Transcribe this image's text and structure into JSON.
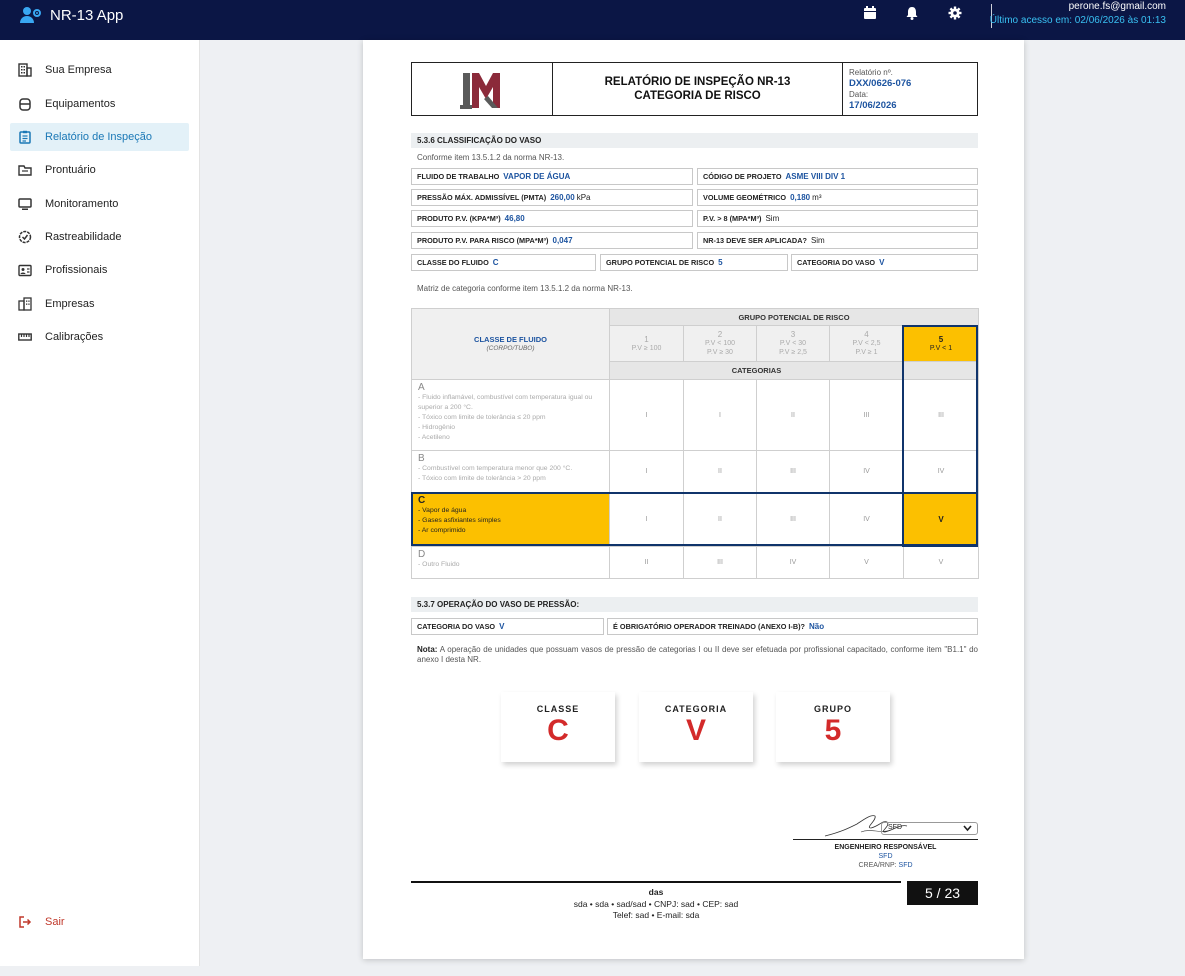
{
  "app": {
    "title": "NR-13 App"
  },
  "topbar": {
    "user_email": "perone.fs@gmail.com",
    "last_access": "Último acesso em: 02/06/2026 às 01:13"
  },
  "sidebar": {
    "items": [
      {
        "label": "Sua Empresa",
        "icon": "building-icon"
      },
      {
        "label": "Equipamentos",
        "icon": "tank-icon"
      },
      {
        "label": "Relatório de Inspeção",
        "icon": "clipboard-icon"
      },
      {
        "label": "Prontuário",
        "icon": "folder-icon"
      },
      {
        "label": "Monitoramento",
        "icon": "monitor-icon"
      },
      {
        "label": "Rastreabilidade",
        "icon": "badge-check-icon"
      },
      {
        "label": "Profissionais",
        "icon": "id-card-icon"
      },
      {
        "label": "Empresas",
        "icon": "buildings-icon"
      },
      {
        "label": "Calibrações",
        "icon": "ruler-icon"
      }
    ],
    "logout": "Sair"
  },
  "report": {
    "title_line1": "RELATÓRIO DE INSPEÇÃO NR-13",
    "title_line2": "CATEGORIA DE RISCO",
    "number_label": "Relatório nº.",
    "number": "DXX/0626-076",
    "date_label": "Data:",
    "date": "17/06/2026",
    "sec1_title": "5.3.6 CLASSIFICAÇÃO DO VASO",
    "sec1_note": "Conforme item 13.5.1.2 da norma NR-13.",
    "fields": {
      "fluido_label": "FLUIDO DE TRABALHO",
      "fluido": "VAPOR DE ÁGUA",
      "codigo_label": "CÓDIGO DE PROJETO",
      "codigo": "ASME VIII DIV 1",
      "pmta_label": "PRESSÃO MÁX. ADMISSÍVEL (PMTA)",
      "pmta": "260,00",
      "pmta_unit": "kPa",
      "volume_label": "VOLUME GEOMÉTRICO",
      "volume": "0,180",
      "volume_unit": "m³",
      "pv_label": "PRODUTO P.V. (KPA*M³)",
      "pv": "46,80",
      "pv8_label": "P.V. > 8 (MPA*M³)",
      "pv8": "Sim",
      "pvrisco_label": "PRODUTO P.V. PARA RISCO (MPA*M³)",
      "pvrisco": "0,047",
      "nr13_label": "NR-13 DEVE SER APLICADA?",
      "nr13": "Sim",
      "classe_label": "CLASSE DO FLUIDO",
      "classe": "C",
      "grupo_label": "GRUPO POTENCIAL DE RISCO",
      "grupo": "5",
      "categoria_label": "CATEGORIA DO VASO",
      "categoria": "V"
    },
    "matrix_note": "Matriz de categoria conforme item 13.5.1.2 da norma NR-13.",
    "matrix": {
      "group_header": "GRUPO POTENCIAL DE RISCO",
      "class_header": "CLASSE DE FLUIDO",
      "class_sub": "(CORPO/TUBO)",
      "categories_header": "CATEGORIAS",
      "groups": [
        {
          "n": "1",
          "l1": "P.V ≥ 100",
          "l2": ""
        },
        {
          "n": "2",
          "l1": "P.V < 100",
          "l2": "P.V ≥ 30"
        },
        {
          "n": "3",
          "l1": "P.V < 30",
          "l2": "P.V ≥ 2,5"
        },
        {
          "n": "4",
          "l1": "P.V < 2,5",
          "l2": "P.V ≥ 1"
        },
        {
          "n": "5",
          "l1": "P.V < 1",
          "l2": ""
        }
      ],
      "rows": [
        {
          "cls": "A",
          "desc": [
            "- Fluido inflamável, combustível com temperatura igual ou superior a 200 °C.",
            "- Tóxico com limite de tolerância ≤ 20 ppm",
            "- Hidrogênio",
            "- Acetileno"
          ],
          "cats": [
            "I",
            "I",
            "II",
            "III",
            "III"
          ]
        },
        {
          "cls": "B",
          "desc": [
            "- Combustível com temperatura menor que 200 °C.",
            "- Tóxico com limite de tolerância > 20 ppm"
          ],
          "cats": [
            "I",
            "II",
            "III",
            "IV",
            "IV"
          ]
        },
        {
          "cls": "C",
          "desc": [
            "- Vapor de água",
            "- Gases asfixiantes simples",
            "- Ar comprimido"
          ],
          "cats": [
            "I",
            "II",
            "III",
            "IV",
            "V"
          ]
        },
        {
          "cls": "D",
          "desc": [
            "- Outro Fluido"
          ],
          "cats": [
            "II",
            "III",
            "IV",
            "V",
            "V"
          ]
        }
      ],
      "selected_row": 2,
      "selected_col": 4
    },
    "sec2_title": "5.3.7 OPERAÇÃO DO VASO DE PRESSÃO:",
    "sec2": {
      "cat_label": "CATEGORIA DO VASO",
      "cat": "V",
      "op_label": "É OBRIGATÓRIO OPERADOR TREINADO (ANEXO I-B)?",
      "op": "Não"
    },
    "nota_label": "Nota:",
    "nota": "A operação de unidades que possuam vasos de pressão de categorias I ou II deve ser efetuada por profissional capacitado, conforme item \"B1.1\" do anexo I desta NR.",
    "summary": [
      {
        "label": "CLASSE",
        "value": "C"
      },
      {
        "label": "CATEGORIA",
        "value": "V"
      },
      {
        "label": "GRUPO",
        "value": "5"
      }
    ],
    "signature": {
      "select": "SFD",
      "role": "ENGENHEIRO RESPONSÁVEL",
      "name": "SFD",
      "crea_label": "CREA/RNP:",
      "crea": "SFD"
    },
    "footer": {
      "company": "das",
      "address": "sda • sda • sad/sad • CNPJ: sad • CEP: sad",
      "contact": "Telef: sad • E-mail: sda",
      "page": "5 / 23"
    }
  },
  "colors": {
    "topbar": "#0b1645",
    "accent": "#1a78b6",
    "highlight": "#fcc000",
    "summary_value": "#d32a2a",
    "link_blue": "#1d54a0"
  }
}
